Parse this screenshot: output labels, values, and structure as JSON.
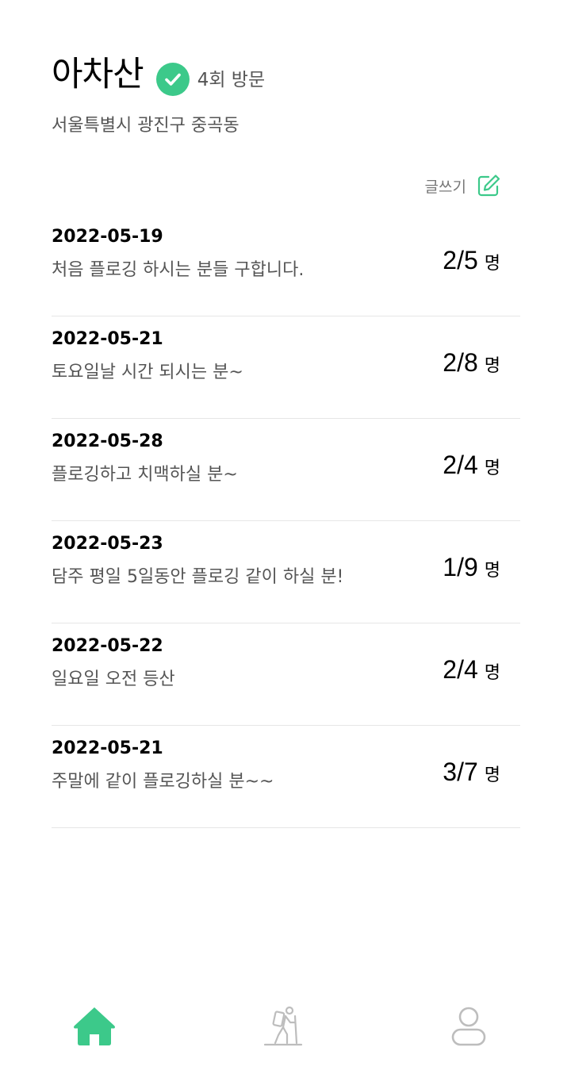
{
  "header": {
    "mountain_name": "아차산",
    "visit_count": "4회 방문",
    "address": "서울특별시 광진구 중곡동"
  },
  "write": {
    "label": "글쓰기"
  },
  "posts": [
    {
      "date": "2022-05-19",
      "title": "처음 플로깅 하시는 분들 구합니다.",
      "count": "2/5",
      "unit": "명"
    },
    {
      "date": "2022-05-21",
      "title": "토요일날 시간 되시는 분~",
      "count": "2/8",
      "unit": "명"
    },
    {
      "date": "2022-05-28",
      "title": "플로깅하고 치맥하실 분~",
      "count": "2/4",
      "unit": "명"
    },
    {
      "date": "2022-05-23",
      "title": "담주 평일 5일동안 플로깅 같이 하실 분!",
      "count": "1/9",
      "unit": "명"
    },
    {
      "date": "2022-05-22",
      "title": "일요일 오전 등산",
      "count": "2/4",
      "unit": "명"
    },
    {
      "date": "2022-05-21",
      "title": "주말에 같이 플로깅하실 분~~",
      "count": "3/7",
      "unit": "명"
    }
  ],
  "nav": {
    "items": [
      {
        "icon": "home-icon",
        "active": true
      },
      {
        "icon": "hiker-icon",
        "active": false
      },
      {
        "icon": "profile-icon",
        "active": false
      }
    ]
  },
  "colors": {
    "accent": "#3cc98a",
    "inactive_icon": "#bdbdbd"
  }
}
